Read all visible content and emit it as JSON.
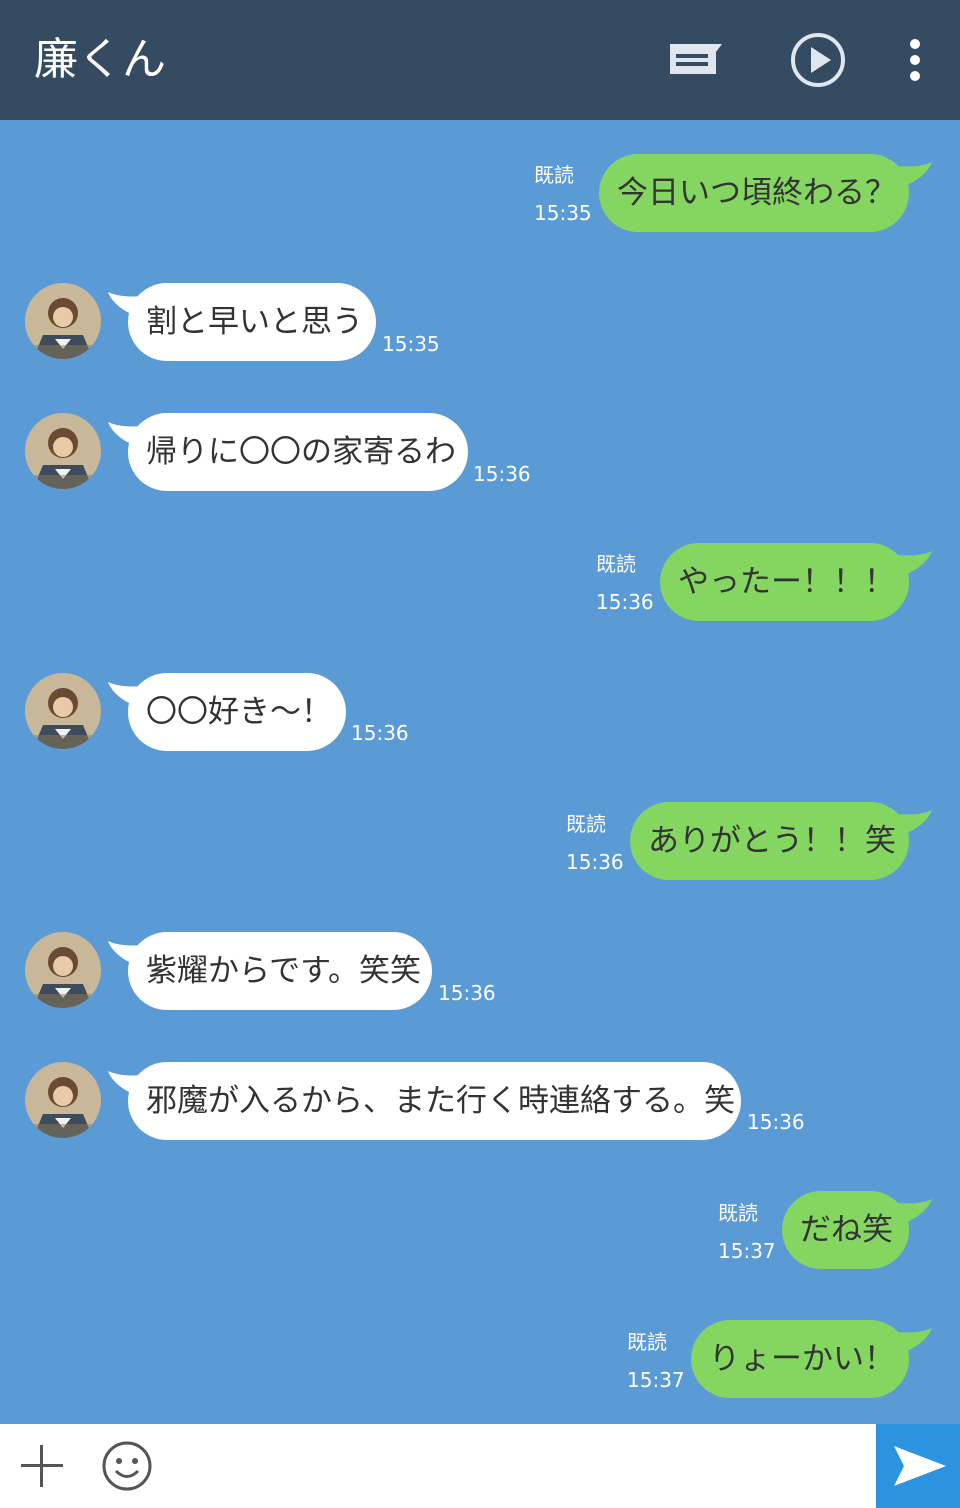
{
  "header": {
    "title": "廉くん",
    "icons": [
      "note-icon",
      "play-icon",
      "more-vertical-icon"
    ]
  },
  "colors": {
    "header_bg": "#344b61",
    "chat_bg": "#5b9bd5",
    "bubble_in": "#ffffff",
    "bubble_out": "#84d660",
    "send_button": "#2b93e0"
  },
  "messages": [
    {
      "direction": "out",
      "text": "今日いつ頃終わる？",
      "read": "既読",
      "time": "15:35"
    },
    {
      "direction": "in",
      "text": "割と早いと思う",
      "time": "15:35"
    },
    {
      "direction": "in",
      "text": "帰りに〇〇の家寄るわ",
      "time": "15:36"
    },
    {
      "direction": "out",
      "text": "やったー！！！",
      "read": "既読",
      "time": "15:36"
    },
    {
      "direction": "in",
      "text": "〇〇好き〜！",
      "time": "15:36"
    },
    {
      "direction": "out",
      "text": "ありがとう！！笑",
      "read": "既読",
      "time": "15:36"
    },
    {
      "direction": "in",
      "text": "紫耀からです。笑笑",
      "time": "15:36"
    },
    {
      "direction": "in",
      "text": "邪魔が入るから、また行く時連絡する。笑",
      "time": "15:36"
    },
    {
      "direction": "out",
      "text": "だね笑",
      "read": "既読",
      "time": "15:37"
    },
    {
      "direction": "out",
      "text": "りょーかい！",
      "read": "既読",
      "time": "15:37"
    }
  ],
  "input_bar": {
    "icons": [
      "plus-icon",
      "emoji-icon",
      "send-icon"
    ]
  }
}
